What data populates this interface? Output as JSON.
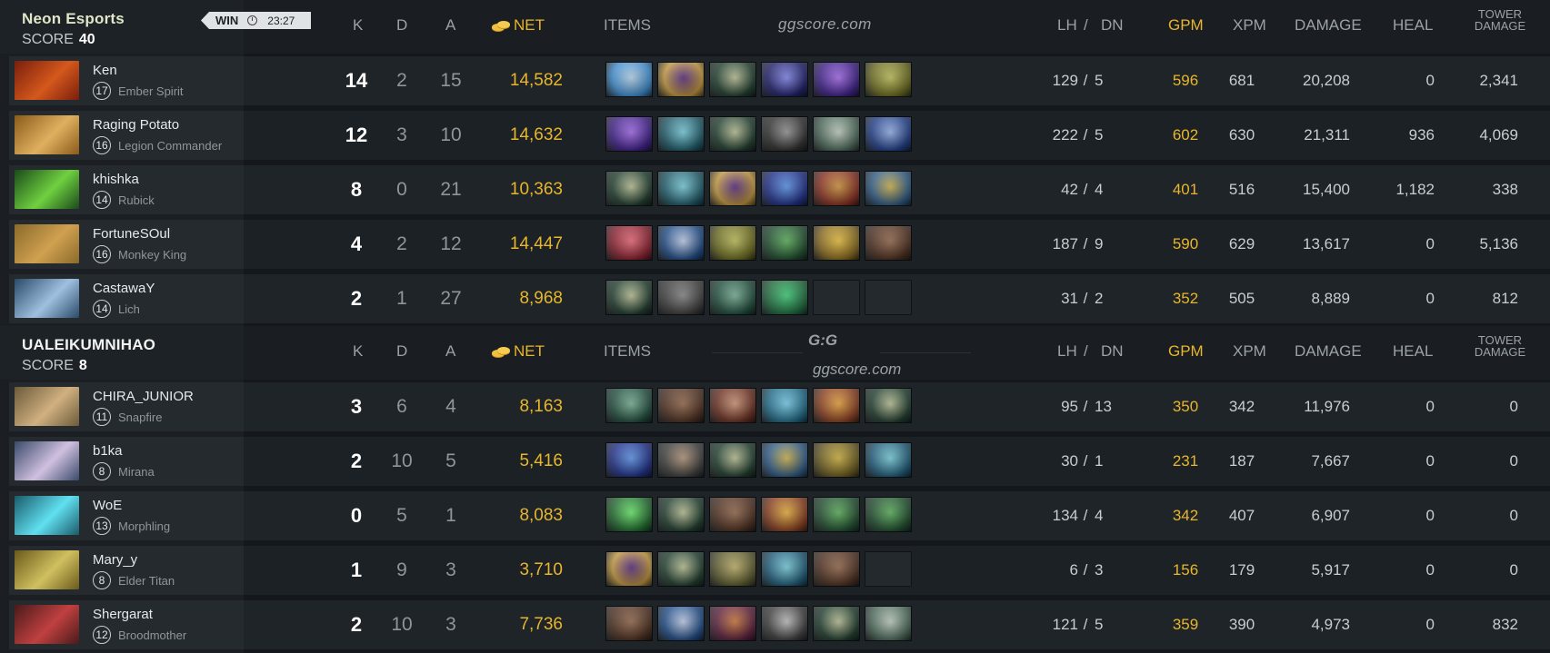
{
  "match": {
    "result": "WIN",
    "duration": "23:27"
  },
  "watermark": {
    "top": "ggscore.com",
    "logo": "G:G",
    "logo_sub": "ggscore.com"
  },
  "headers": {
    "k": "K",
    "d": "D",
    "a": "A",
    "net": "NET",
    "items": "ITEMS",
    "lh": "LH",
    "sep": "/",
    "dn": "DN",
    "gpm": "GPM",
    "xpm": "XPM",
    "damage": "DAMAGE",
    "heal": "HEAL",
    "tower1": "TOWER",
    "tower2": "DAMAGE"
  },
  "score_label": "SCORE",
  "teams": [
    {
      "name": "Neon Esports",
      "score": "40",
      "players": [
        {
          "name": "Ken",
          "level": "17",
          "hero": "Ember Spirit",
          "k": "14",
          "d": "2",
          "a": "15",
          "net": "14,582",
          "lh": "129",
          "dn": "5",
          "gpm": "596",
          "xpm": "681",
          "damage": "20,208",
          "heal": "0",
          "tower": "2,341",
          "portrait": [
            "#7a1e0c",
            "#d4581c"
          ],
          "items": [
            [
              "#3a8fd8",
              "#c8e8ff"
            ],
            [
              "#c89a3a",
              "#5a2a8a"
            ],
            [
              "#1a3a2a",
              "#c8d0a0"
            ],
            [
              "#1a1a6a",
              "#8a90ff"
            ],
            [
              "#3a1a8a",
              "#b070ff"
            ],
            [
              "#6a6a1a",
              "#d0d060"
            ]
          ]
        },
        {
          "name": "Raging Potato",
          "level": "16",
          "hero": "Legion Commander",
          "k": "12",
          "d": "3",
          "a": "10",
          "net": "14,632",
          "lh": "222",
          "dn": "5",
          "gpm": "602",
          "xpm": "630",
          "damage": "21,311",
          "heal": "936",
          "tower": "4,069",
          "portrait": [
            "#8a5a1a",
            "#e0b060"
          ],
          "items": [
            [
              "#3a1a8a",
              "#b070ff"
            ],
            [
              "#1a5a6a",
              "#80e0f0"
            ],
            [
              "#1a3a2a",
              "#c8d0a0"
            ],
            [
              "#2a2a2a",
              "#a0a0a0"
            ],
            [
              "#4a6a5a",
              "#d0e0d0"
            ],
            [
              "#1a3a8a",
              "#a0c0ff"
            ]
          ]
        },
        {
          "name": "khishka",
          "level": "14",
          "hero": "Rubick",
          "k": "8",
          "d": "0",
          "a": "21",
          "net": "10,363",
          "lh": "42",
          "dn": "4",
          "gpm": "401",
          "xpm": "516",
          "damage": "15,400",
          "heal": "1,182",
          "tower": "338",
          "portrait": [
            "#1a4a1a",
            "#70d040"
          ],
          "items": [
            [
              "#1a3a2a",
              "#c8d0a0"
            ],
            [
              "#1a5a6a",
              "#80e0f0"
            ],
            [
              "#c89a3a",
              "#5a2a8a"
            ],
            [
              "#1a2a8a",
              "#60a0ff"
            ],
            [
              "#8a2a1a",
              "#e0a040"
            ],
            [
              "#2a5a8a",
              "#e0c050"
            ]
          ]
        },
        {
          "name": "FortuneSOul",
          "level": "16",
          "hero": "Monkey King",
          "k": "4",
          "d": "2",
          "a": "12",
          "net": "14,447",
          "lh": "187",
          "dn": "9",
          "gpm": "590",
          "xpm": "629",
          "damage": "13,617",
          "heal": "0",
          "tower": "5,136",
          "portrait": [
            "#8a6a2a",
            "#d0a050"
          ],
          "items": [
            [
              "#8a1a2a",
              "#ff7080"
            ],
            [
              "#1a4a8a",
              "#d0e0ff"
            ],
            [
              "#6a6a1a",
              "#d0d060"
            ],
            [
              "#1a4a2a",
              "#60c060"
            ],
            [
              "#8a6a1a",
              "#ffd040"
            ],
            [
              "#4a2a1a",
              "#a07050"
            ]
          ]
        },
        {
          "name": "CastawaY",
          "level": "14",
          "hero": "Lich",
          "k": "2",
          "d": "1",
          "a": "27",
          "net": "8,968",
          "lh": "31",
          "dn": "2",
          "gpm": "352",
          "xpm": "505",
          "damage": "8,889",
          "heal": "0",
          "tower": "812",
          "portrait": [
            "#2a4a6a",
            "#a0c0e0"
          ],
          "items": [
            [
              "#1a3a2a",
              "#c8d0a0"
            ],
            [
              "#3a3a3a",
              "#909090"
            ],
            [
              "#1a4a3a",
              "#80c0a0"
            ],
            [
              "#1a6a3a",
              "#40e080"
            ],
            null,
            null
          ]
        }
      ]
    },
    {
      "name": "UALEIKUMNIHAO",
      "score": "8",
      "players": [
        {
          "name": "CHIRA_JUNIOR",
          "level": "11",
          "hero": "Snapfire",
          "k": "3",
          "d": "6",
          "a": "4",
          "net": "8,163",
          "lh": "95",
          "dn": "13",
          "gpm": "350",
          "xpm": "342",
          "damage": "11,976",
          "heal": "0",
          "tower": "0",
          "portrait": [
            "#6a5a3a",
            "#d0b080"
          ],
          "items": [
            [
              "#1a4a3a",
              "#80c0a0"
            ],
            [
              "#4a2a1a",
              "#a07050"
            ],
            [
              "#6a2a1a",
              "#e0a080"
            ],
            [
              "#1a6a8a",
              "#80e0ff"
            ],
            [
              "#8a3a1a",
              "#ffb040"
            ],
            [
              "#1a3a2a",
              "#c8d0a0"
            ]
          ]
        },
        {
          "name": "b1ka",
          "level": "8",
          "hero": "Mirana",
          "k": "2",
          "d": "10",
          "a": "5",
          "net": "5,416",
          "lh": "30",
          "dn": "1",
          "gpm": "231",
          "xpm": "187",
          "damage": "7,667",
          "heal": "0",
          "tower": "0",
          "portrait": [
            "#3a4a6a",
            "#d0c0e0"
          ],
          "items": [
            [
              "#1a2a8a",
              "#60a0ff"
            ],
            [
              "#3a3a3a",
              "#c0a080"
            ],
            [
              "#1a3a2a",
              "#c8d0a0"
            ],
            [
              "#2a5a8a",
              "#e0c050"
            ],
            [
              "#6a5a1a",
              "#e0c040"
            ],
            [
              "#1a5a7a",
              "#80e0f0"
            ]
          ]
        },
        {
          "name": "WoE",
          "level": "13",
          "hero": "Morphling",
          "k": "0",
          "d": "5",
          "a": "1",
          "net": "8,083",
          "lh": "134",
          "dn": "4",
          "gpm": "342",
          "xpm": "407",
          "damage": "6,907",
          "heal": "0",
          "tower": "0",
          "portrait": [
            "#1a5a6a",
            "#60e0f0"
          ],
          "items": [
            [
              "#1a6a2a",
              "#70ff70"
            ],
            [
              "#1a3a2a",
              "#c8d0a0"
            ],
            [
              "#4a2a1a",
              "#a07050"
            ],
            [
              "#8a3a1a",
              "#ffc040"
            ],
            [
              "#1a4a2a",
              "#60c060"
            ],
            [
              "#1a4a2a",
              "#60c060"
            ]
          ]
        },
        {
          "name": "Mary_y",
          "level": "8",
          "hero": "Elder Titan",
          "k": "1",
          "d": "9",
          "a": "3",
          "net": "3,710",
          "lh": "6",
          "dn": "3",
          "gpm": "156",
          "xpm": "179",
          "damage": "5,917",
          "heal": "0",
          "tower": "0",
          "portrait": [
            "#6a5a1a",
            "#d0c060"
          ],
          "items": [
            [
              "#c89a3a",
              "#5a2a8a"
            ],
            [
              "#1a3a2a",
              "#c8d0a0"
            ],
            [
              "#5a5a2a",
              "#d0c070"
            ],
            [
              "#1a5a7a",
              "#80e0f0"
            ],
            [
              "#4a2a1a",
              "#a07050"
            ],
            null
          ]
        },
        {
          "name": "Shergarat",
          "level": "12",
          "hero": "Broodmother",
          "k": "2",
          "d": "10",
          "a": "3",
          "net": "7,736",
          "lh": "121",
          "dn": "5",
          "gpm": "359",
          "xpm": "390",
          "damage": "4,973",
          "heal": "0",
          "tower": "832",
          "portrait": [
            "#4a1a1a",
            "#c04040"
          ],
          "items": [
            [
              "#4a2a1a",
              "#a07050"
            ],
            [
              "#1a4a8a",
              "#d0e0ff"
            ],
            [
              "#5a1a3a",
              "#e08040"
            ],
            [
              "#3a3a3a",
              "#d0d0d0"
            ],
            [
              "#1a3a2a",
              "#c8d0a0"
            ],
            [
              "#4a6a5a",
              "#d0e0d0"
            ]
          ]
        }
      ]
    }
  ]
}
